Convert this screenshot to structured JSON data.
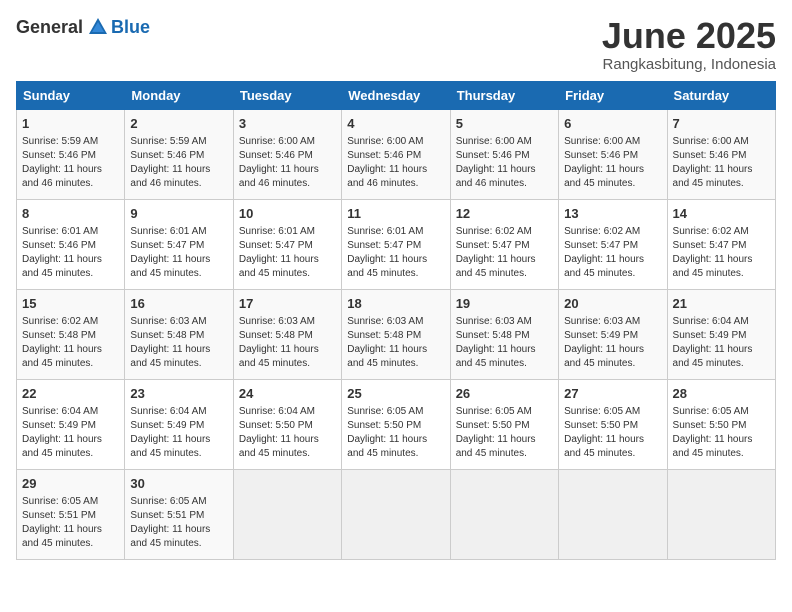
{
  "logo": {
    "general": "General",
    "blue": "Blue"
  },
  "title": "June 2025",
  "subtitle": "Rangkasbitung, Indonesia",
  "days_header": [
    "Sunday",
    "Monday",
    "Tuesday",
    "Wednesday",
    "Thursday",
    "Friday",
    "Saturday"
  ],
  "weeks": [
    [
      {
        "day": "1",
        "sunrise": "Sunrise: 5:59 AM",
        "sunset": "Sunset: 5:46 PM",
        "daylight": "Daylight: 11 hours and 46 minutes."
      },
      {
        "day": "2",
        "sunrise": "Sunrise: 5:59 AM",
        "sunset": "Sunset: 5:46 PM",
        "daylight": "Daylight: 11 hours and 46 minutes."
      },
      {
        "day": "3",
        "sunrise": "Sunrise: 6:00 AM",
        "sunset": "Sunset: 5:46 PM",
        "daylight": "Daylight: 11 hours and 46 minutes."
      },
      {
        "day": "4",
        "sunrise": "Sunrise: 6:00 AM",
        "sunset": "Sunset: 5:46 PM",
        "daylight": "Daylight: 11 hours and 46 minutes."
      },
      {
        "day": "5",
        "sunrise": "Sunrise: 6:00 AM",
        "sunset": "Sunset: 5:46 PM",
        "daylight": "Daylight: 11 hours and 46 minutes."
      },
      {
        "day": "6",
        "sunrise": "Sunrise: 6:00 AM",
        "sunset": "Sunset: 5:46 PM",
        "daylight": "Daylight: 11 hours and 45 minutes."
      },
      {
        "day": "7",
        "sunrise": "Sunrise: 6:00 AM",
        "sunset": "Sunset: 5:46 PM",
        "daylight": "Daylight: 11 hours and 45 minutes."
      }
    ],
    [
      {
        "day": "8",
        "sunrise": "Sunrise: 6:01 AM",
        "sunset": "Sunset: 5:46 PM",
        "daylight": "Daylight: 11 hours and 45 minutes."
      },
      {
        "day": "9",
        "sunrise": "Sunrise: 6:01 AM",
        "sunset": "Sunset: 5:47 PM",
        "daylight": "Daylight: 11 hours and 45 minutes."
      },
      {
        "day": "10",
        "sunrise": "Sunrise: 6:01 AM",
        "sunset": "Sunset: 5:47 PM",
        "daylight": "Daylight: 11 hours and 45 minutes."
      },
      {
        "day": "11",
        "sunrise": "Sunrise: 6:01 AM",
        "sunset": "Sunset: 5:47 PM",
        "daylight": "Daylight: 11 hours and 45 minutes."
      },
      {
        "day": "12",
        "sunrise": "Sunrise: 6:02 AM",
        "sunset": "Sunset: 5:47 PM",
        "daylight": "Daylight: 11 hours and 45 minutes."
      },
      {
        "day": "13",
        "sunrise": "Sunrise: 6:02 AM",
        "sunset": "Sunset: 5:47 PM",
        "daylight": "Daylight: 11 hours and 45 minutes."
      },
      {
        "day": "14",
        "sunrise": "Sunrise: 6:02 AM",
        "sunset": "Sunset: 5:47 PM",
        "daylight": "Daylight: 11 hours and 45 minutes."
      }
    ],
    [
      {
        "day": "15",
        "sunrise": "Sunrise: 6:02 AM",
        "sunset": "Sunset: 5:48 PM",
        "daylight": "Daylight: 11 hours and 45 minutes."
      },
      {
        "day": "16",
        "sunrise": "Sunrise: 6:03 AM",
        "sunset": "Sunset: 5:48 PM",
        "daylight": "Daylight: 11 hours and 45 minutes."
      },
      {
        "day": "17",
        "sunrise": "Sunrise: 6:03 AM",
        "sunset": "Sunset: 5:48 PM",
        "daylight": "Daylight: 11 hours and 45 minutes."
      },
      {
        "day": "18",
        "sunrise": "Sunrise: 6:03 AM",
        "sunset": "Sunset: 5:48 PM",
        "daylight": "Daylight: 11 hours and 45 minutes."
      },
      {
        "day": "19",
        "sunrise": "Sunrise: 6:03 AM",
        "sunset": "Sunset: 5:48 PM",
        "daylight": "Daylight: 11 hours and 45 minutes."
      },
      {
        "day": "20",
        "sunrise": "Sunrise: 6:03 AM",
        "sunset": "Sunset: 5:49 PM",
        "daylight": "Daylight: 11 hours and 45 minutes."
      },
      {
        "day": "21",
        "sunrise": "Sunrise: 6:04 AM",
        "sunset": "Sunset: 5:49 PM",
        "daylight": "Daylight: 11 hours and 45 minutes."
      }
    ],
    [
      {
        "day": "22",
        "sunrise": "Sunrise: 6:04 AM",
        "sunset": "Sunset: 5:49 PM",
        "daylight": "Daylight: 11 hours and 45 minutes."
      },
      {
        "day": "23",
        "sunrise": "Sunrise: 6:04 AM",
        "sunset": "Sunset: 5:49 PM",
        "daylight": "Daylight: 11 hours and 45 minutes."
      },
      {
        "day": "24",
        "sunrise": "Sunrise: 6:04 AM",
        "sunset": "Sunset: 5:50 PM",
        "daylight": "Daylight: 11 hours and 45 minutes."
      },
      {
        "day": "25",
        "sunrise": "Sunrise: 6:05 AM",
        "sunset": "Sunset: 5:50 PM",
        "daylight": "Daylight: 11 hours and 45 minutes."
      },
      {
        "day": "26",
        "sunrise": "Sunrise: 6:05 AM",
        "sunset": "Sunset: 5:50 PM",
        "daylight": "Daylight: 11 hours and 45 minutes."
      },
      {
        "day": "27",
        "sunrise": "Sunrise: 6:05 AM",
        "sunset": "Sunset: 5:50 PM",
        "daylight": "Daylight: 11 hours and 45 minutes."
      },
      {
        "day": "28",
        "sunrise": "Sunrise: 6:05 AM",
        "sunset": "Sunset: 5:50 PM",
        "daylight": "Daylight: 11 hours and 45 minutes."
      }
    ],
    [
      {
        "day": "29",
        "sunrise": "Sunrise: 6:05 AM",
        "sunset": "Sunset: 5:51 PM",
        "daylight": "Daylight: 11 hours and 45 minutes."
      },
      {
        "day": "30",
        "sunrise": "Sunrise: 6:05 AM",
        "sunset": "Sunset: 5:51 PM",
        "daylight": "Daylight: 11 hours and 45 minutes."
      },
      null,
      null,
      null,
      null,
      null
    ]
  ]
}
